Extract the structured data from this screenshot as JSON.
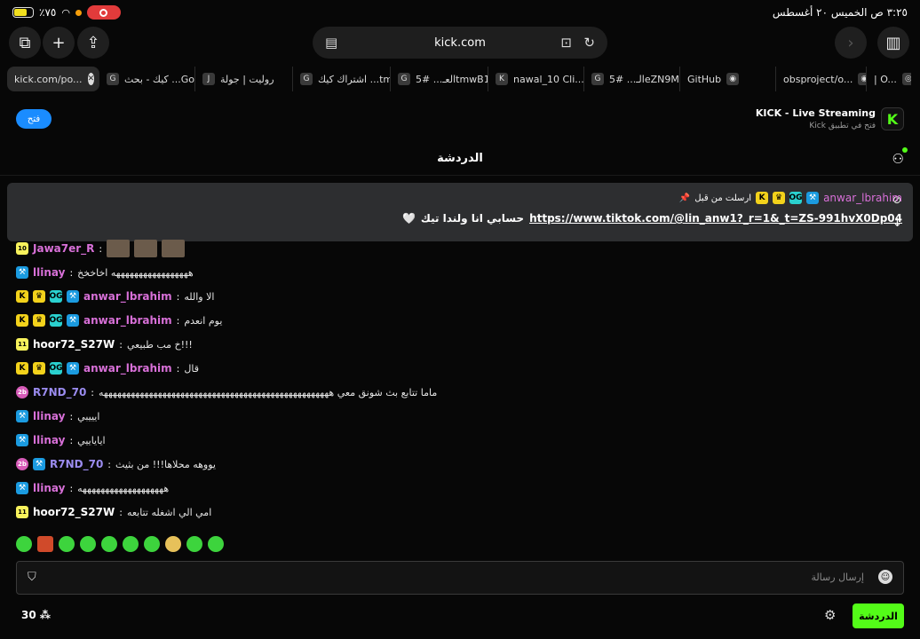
{
  "status_bar": {
    "battery": "٪٧٥",
    "time_date": "٣:٢٥ ص  الخميس ٢٠ أغسطس"
  },
  "toolbar": {
    "url": "kick.com"
  },
  "tabs": [
    {
      "label": "kick.com/po...",
      "active": true
    },
    {
      "label": "كيك - بحث ...Go",
      "fav": "G"
    },
    {
      "label": "روليت | جولة",
      "fav": "J"
    },
    {
      "label": "اشتراك كيك ...tm",
      "fav": "G"
    },
    {
      "label": "العـ... #5tmwB1",
      "fav": "G"
    },
    {
      "label": "nawal_10 Cli...",
      "fav": "K"
    },
    {
      "label": "الـ... #5eZN9M",
      "fav": "G"
    },
    {
      "label": "GitHub",
      "fav": "◉"
    },
    {
      "label": "obsproject/o...",
      "fav": "◉"
    },
    {
      "label": "| O...",
      "fav": "◎"
    }
  ],
  "banner": {
    "open_label": "فتح",
    "title": "KICK - Live Streaming",
    "subtitle": "فتح في تطبيق Kick"
  },
  "chat": {
    "title": "الدردشة",
    "pinned": {
      "username": "anwar_lbrahim",
      "note": "ارسلت من قبل",
      "link": "https://www.tiktok.com/@lin_anw1?_r=1&_t=ZS-991hvX0Dp04",
      "text": "حسابي انا ولندا تيك"
    },
    "messages": [
      {
        "user": "Jawa7er_R",
        "color": "#d870d8",
        "text": "",
        "emotes": 3
      },
      {
        "user": "llinay",
        "color": "#d870d8",
        "text": "هههههههههههههههههه اخاخخخ"
      },
      {
        "user": "anwar_lbrahim",
        "color": "#d870d8",
        "text": "الا والله"
      },
      {
        "user": "anwar_lbrahim",
        "color": "#d870d8",
        "text": "يوم انعدم"
      },
      {
        "user": "hoor72_S27W",
        "color": "#ffffff",
        "text": "!!!خ مب طبيعي"
      },
      {
        "user": "anwar_lbrahim",
        "color": "#d870d8",
        "text": "قال"
      },
      {
        "user": "R7ND_70",
        "color": "#9b8cf0",
        "text": "ماما تتابع بث شونق معي هههههههههههههههههههههههههههههههههههههههههههههههههههه"
      },
      {
        "user": "llinay",
        "color": "#d870d8",
        "text": "ايييبي"
      },
      {
        "user": "llinay",
        "color": "#d870d8",
        "text": "اياياييي"
      },
      {
        "user": "R7ND_70",
        "color": "#9b8cf0",
        "text": "يووهه محلاها!!! من بثيث"
      },
      {
        "user": "llinay",
        "color": "#d870d8",
        "text": "هههههههههههههههههههه"
      },
      {
        "user": "hoor72_S27W",
        "color": "#ffffff",
        "text": "امي الي اشغله تتابعه"
      }
    ],
    "input_placeholder": "إرسال رسالة",
    "viewer_count": "30",
    "chat_button": "الدردشة"
  }
}
